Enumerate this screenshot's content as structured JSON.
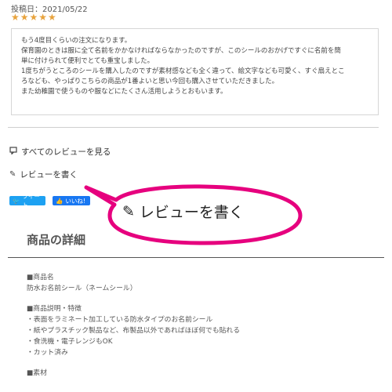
{
  "review": {
    "post_date": "投稿日：2021/05/22",
    "stars": "★★★★★",
    "lines": [
      "もう4度目くらいの注文になります。",
      "保育園のときは服に全て名前をかかなければならなかったのですが、このシールのおかげですぐに名前を簡",
      "単に付けられて便利でとても重宝しました。",
      "1度ちがうところのシールを購入したのですが素材感なども全く違って、絵文字なども可愛く、すぐ扇えとこ",
      "ろなども、やっぱりこちらの商品が1番よいと思い今回も購入させていただきました。",
      "また幼稚園で使うものや服などにたくさん活用しようとおもいます。"
    ]
  },
  "links": {
    "all_reviews": "すべてのレビューを見る",
    "write_review": "レビューを書く"
  },
  "social": {
    "tweet": "ツイート",
    "like": "いいね!"
  },
  "callout": {
    "text": "レビューを書く",
    "color": "#e6007e"
  },
  "product": {
    "section_title": "商品の詳細",
    "name_heading": "■商品名",
    "name": "防水お名前シール（ネームシール）",
    "desc_heading": "■商品説明・特徴",
    "desc_items": [
      "・表面をラミネート加工している防水タイプのお名前シール",
      "・紙やプラスチック製品など、布製品以外であればほぼ何でも貼れる",
      "・食洗機・電子レンジもOK",
      "・カット済み"
    ],
    "material_heading": "■素材"
  }
}
